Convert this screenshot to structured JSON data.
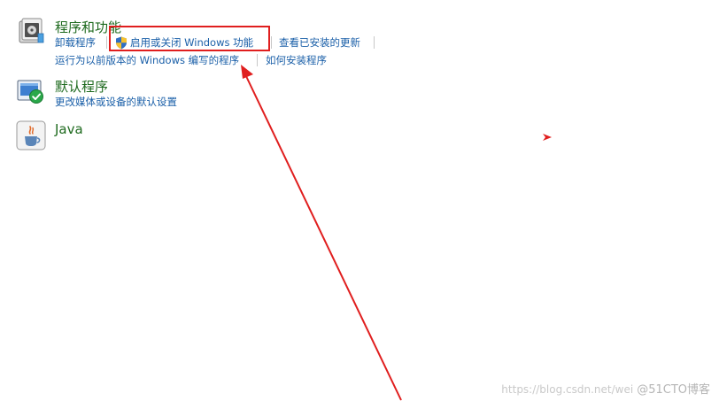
{
  "programs": {
    "title": "程序和功能",
    "links": {
      "uninstall": "卸载程序",
      "toggle_features": "启用或关闭 Windows 功能",
      "view_updates": "查看已安装的更新",
      "run_old": "运行为以前版本的 Windows 编写的程序",
      "how_install": "如何安装程序"
    }
  },
  "defaults": {
    "title": "默认程序",
    "links": {
      "change_defaults": "更改媒体或设备的默认设置"
    }
  },
  "java": {
    "title": "Java"
  },
  "watermark": {
    "url": "https://blog.csdn.net/wei",
    "brand": "@51CTO博客"
  },
  "colors": {
    "category_title": "#1e6a1e",
    "link": "#1a5fa8",
    "annotation": "#e01e1e"
  },
  "icons": {
    "programs": "programs-features-icon",
    "uac_shield": "uac-shield-icon",
    "defaults": "default-programs-icon",
    "java": "java-icon"
  }
}
